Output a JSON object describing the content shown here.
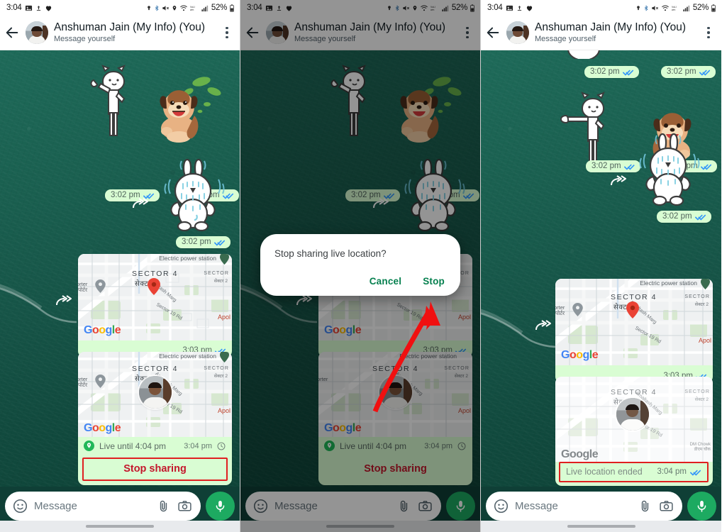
{
  "status_bar": {
    "time": "3:04",
    "battery_percent": "52%",
    "left_icons": [
      "screenshot-icon",
      "upload-icon",
      "heart-icon"
    ],
    "right_icons": [
      "flashlight-icon",
      "bluetooth-icon",
      "mute-icon",
      "location-icon",
      "wifi-icon",
      "volte-icon",
      "signal-icon",
      "battery-icon"
    ],
    "location_icon_visible_panels": [
      1,
      2
    ]
  },
  "header": {
    "back_icon": "back-arrow-icon",
    "avatar": "contact-avatar",
    "title": "Anshuman Jain (My Info) (You)",
    "subtitle": "Message yourself",
    "menu_icon": "overflow-menu-icon"
  },
  "composer": {
    "emoji_icon": "emoji-icon",
    "placeholder": "Message",
    "attach_icon": "paperclip-icon",
    "camera_icon": "camera-icon",
    "mic_icon": "microphone-icon"
  },
  "colors": {
    "outgoing_bubble": "#d9fdd3",
    "chat_background": "#165447",
    "accent_green": "#1daa61",
    "dialog_action": "#06804f",
    "highlight_red": "#e02020",
    "stop_sharing_text": "#c4172c",
    "tick_blue": "#3497f9"
  },
  "map": {
    "label_sector4": "SECTOR 4",
    "label_sector4_hi": "सेक्टर 4",
    "label_sector2": "SECTOR",
    "label_sector2_hi": "सेक्टर 2",
    "label_power_station": "Electric power station",
    "label_apollo": "Apol",
    "label_road_main": "Amaltash Marg",
    "label_road_sector19": "Sector 19 Rd",
    "label_porter": "orter",
    "label_porter_hi": "पोर्टर",
    "label_chowk": "DM Chowk",
    "label_chowk_hi": "डीएम चौक",
    "google_logo": "Google",
    "pin_icon": "map-pin-icon"
  },
  "panels": [
    {
      "id": 1,
      "stickers": [
        {
          "name": "sticker-cat-waving",
          "time": "3:02 pm",
          "status": "read"
        },
        {
          "name": "sticker-dog-happy",
          "time": "3:02 pm",
          "status": "read"
        },
        {
          "name": "sticker-rabbit-sweating",
          "time": "3:02 pm",
          "status": "read",
          "forwarded": true
        }
      ],
      "location_message": {
        "name": "static-location-bubble",
        "time": "3:03 pm",
        "status": "read"
      },
      "live_location_message": {
        "name": "live-location-bubble",
        "live_until": "Live until 4:04 pm",
        "time": "3:04 pm",
        "live_pin_icon": "live-location-pin-icon",
        "clock_icon": "clock-icon",
        "action_label": "Stop sharing",
        "highlighted": true
      }
    },
    {
      "id": 2,
      "dimmed": true,
      "dialog": {
        "name": "stop-sharing-dialog",
        "title": "Stop sharing live location?",
        "cancel_label": "Cancel",
        "confirm_label": "Stop"
      },
      "annotation": {
        "name": "red-arrow-annotation",
        "points_to": "Stop"
      },
      "location_message": {
        "time": "3:03 pm",
        "status": "read"
      },
      "live_location_message": {
        "live_until": "Live until 4:04 pm",
        "time": "3:04 pm",
        "action_label": "Stop sharing"
      }
    },
    {
      "id": 3,
      "stickers": [
        {
          "name": "sticker-cat-pointing",
          "time": "3:02 pm",
          "status": "read"
        },
        {
          "name": "sticker-dog-left",
          "time": "3:02 pm",
          "status": "read"
        },
        {
          "name": "sticker-rabbit-sweating",
          "time": "3:02 pm",
          "status": "read",
          "forwarded": true
        }
      ],
      "location_message": {
        "name": "static-location-bubble",
        "time": "3:03 pm",
        "status": "read"
      },
      "live_location_message": {
        "name": "ended-location-bubble",
        "ended_label": "Live location ended",
        "time": "3:04 pm",
        "highlighted": true
      },
      "top_sticker_times": [
        "3:02 pm",
        "3:02 pm"
      ]
    }
  ]
}
